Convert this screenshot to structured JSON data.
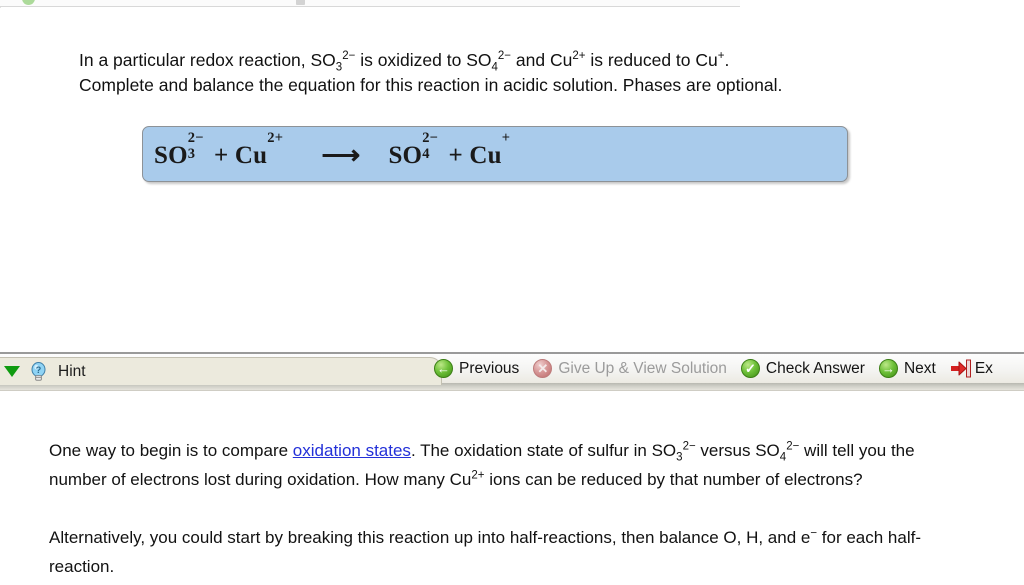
{
  "top_strip": {
    "partial_text": "cut-off toolbar",
    "green_icon": "green-circle-icon",
    "square_icon": "grey-square-icon"
  },
  "question": {
    "line1_a": "In a particular redox reaction, SO",
    "line1_so3_sub": "3",
    "line1_so3_sup": "2−",
    "line1_b": " is oxidized to SO",
    "line1_so4_sub": "4",
    "line1_so4_sup": "2−",
    "line1_c": " and Cu",
    "line1_cu2_sup": "2+",
    "line1_d": " is reduced to Cu",
    "line1_cu1_sup": "+",
    "line1_e": ".",
    "line2": "Complete and balance the equation for this reaction in acidic solution. Phases are optional."
  },
  "equation_box": {
    "fill_color": "#a9cbeb",
    "border_color": "#8d9297",
    "reactant1_base": "SO",
    "reactant1_sup": "2−",
    "reactant1_sub": "3",
    "plus1": "+",
    "reactant2_base": "Cu",
    "reactant2_sup": "2+",
    "arrow": "⟶",
    "product1_base": "SO",
    "product1_sup": "2−",
    "product1_sub": "4",
    "plus2": "+",
    "product2_base": "Cu",
    "product2_sup": "+"
  },
  "toolbar": {
    "hint_tab": {
      "collapse_arrow": "triangle-down-icon",
      "bulb_icon": "lightbulb-hint-icon",
      "label": "Hint"
    },
    "buttons": [
      {
        "label": "Previous",
        "icon": "back-arrow-circle-icon",
        "glyph": "←",
        "style": "green",
        "disabled": false
      },
      {
        "label": "Give Up & View Solution",
        "icon": "cancel-x-circle-icon",
        "glyph": "✕",
        "style": "red-dim",
        "disabled": true
      },
      {
        "label": "Check Answer",
        "icon": "check-circle-icon",
        "glyph": "✓",
        "style": "green",
        "disabled": false
      },
      {
        "label": "Next",
        "icon": "forward-arrow-circle-icon",
        "glyph": "→",
        "style": "green",
        "disabled": false
      },
      {
        "label": "Ex",
        "icon": "exit-door-arrow-icon",
        "glyph": "",
        "style": "exit",
        "disabled": false
      }
    ]
  },
  "hint_panel": {
    "p1_a": "One way to begin is to compare ",
    "p1_link": "oxidation states",
    "p1_b": ". The oxidation state of sulfur in SO",
    "p1_so3_sub": "3",
    "p1_so3_sup": "2−",
    "p1_c": " versus SO",
    "p1_so4_sub": "4",
    "p1_so4_sup": "2−",
    "p1_d": " will tell you the number of electrons lost during oxidation. How many Cu",
    "p1_cu_sup": "2+",
    "p1_e": " ions can be reduced by that number of electrons?",
    "p2_a": "Alternatively, you could start by breaking this reaction up into half-reactions, then balance O, H, and e",
    "p2_sup": "−",
    "p2_b": " for each half-reaction."
  }
}
